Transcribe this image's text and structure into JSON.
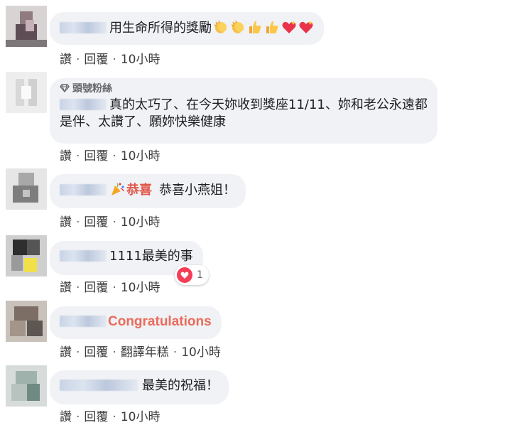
{
  "comments": [
    {
      "text": "用生命所得的獎勵",
      "emojis": [
        "clapping-hands-icon",
        "clapping-hands-icon",
        "thumbs-up-icon",
        "thumbs-up-icon",
        "sparkling-heart-icon",
        "sparkling-heart-icon"
      ],
      "actions": {
        "like": "讚",
        "reply": "回覆",
        "time": "10小時"
      }
    },
    {
      "badge": "頭號粉絲",
      "text_line1": "真的太巧了、在今天妳收到獎座11/11、妳和老公永遠都",
      "text_line2": "是伴、太讚了、願妳快樂健康",
      "actions": {
        "like": "讚",
        "reply": "回覆",
        "time": "10小時"
      }
    },
    {
      "tag": "恭喜",
      "text": "恭喜小燕姐！",
      "actions": {
        "like": "讚",
        "reply": "回覆",
        "time": "10小時"
      }
    },
    {
      "text": "1111最美的事",
      "reaction_count": "1",
      "actions": {
        "like": "讚",
        "reply": "回覆",
        "time": "10小時"
      }
    },
    {
      "text": "Congratulations",
      "actions": {
        "like": "讚",
        "reply": "回覆",
        "translate": "翻譯年糕",
        "time": "10小時"
      }
    },
    {
      "text": "最美的祝福！",
      "actions": {
        "like": "讚",
        "reply": "回覆",
        "time": "10小時"
      }
    }
  ],
  "separator": "·",
  "colors": {
    "bubble": "#f0f2f5",
    "accent_red": "#e2574c",
    "reaction_heart": "#f33e58"
  }
}
